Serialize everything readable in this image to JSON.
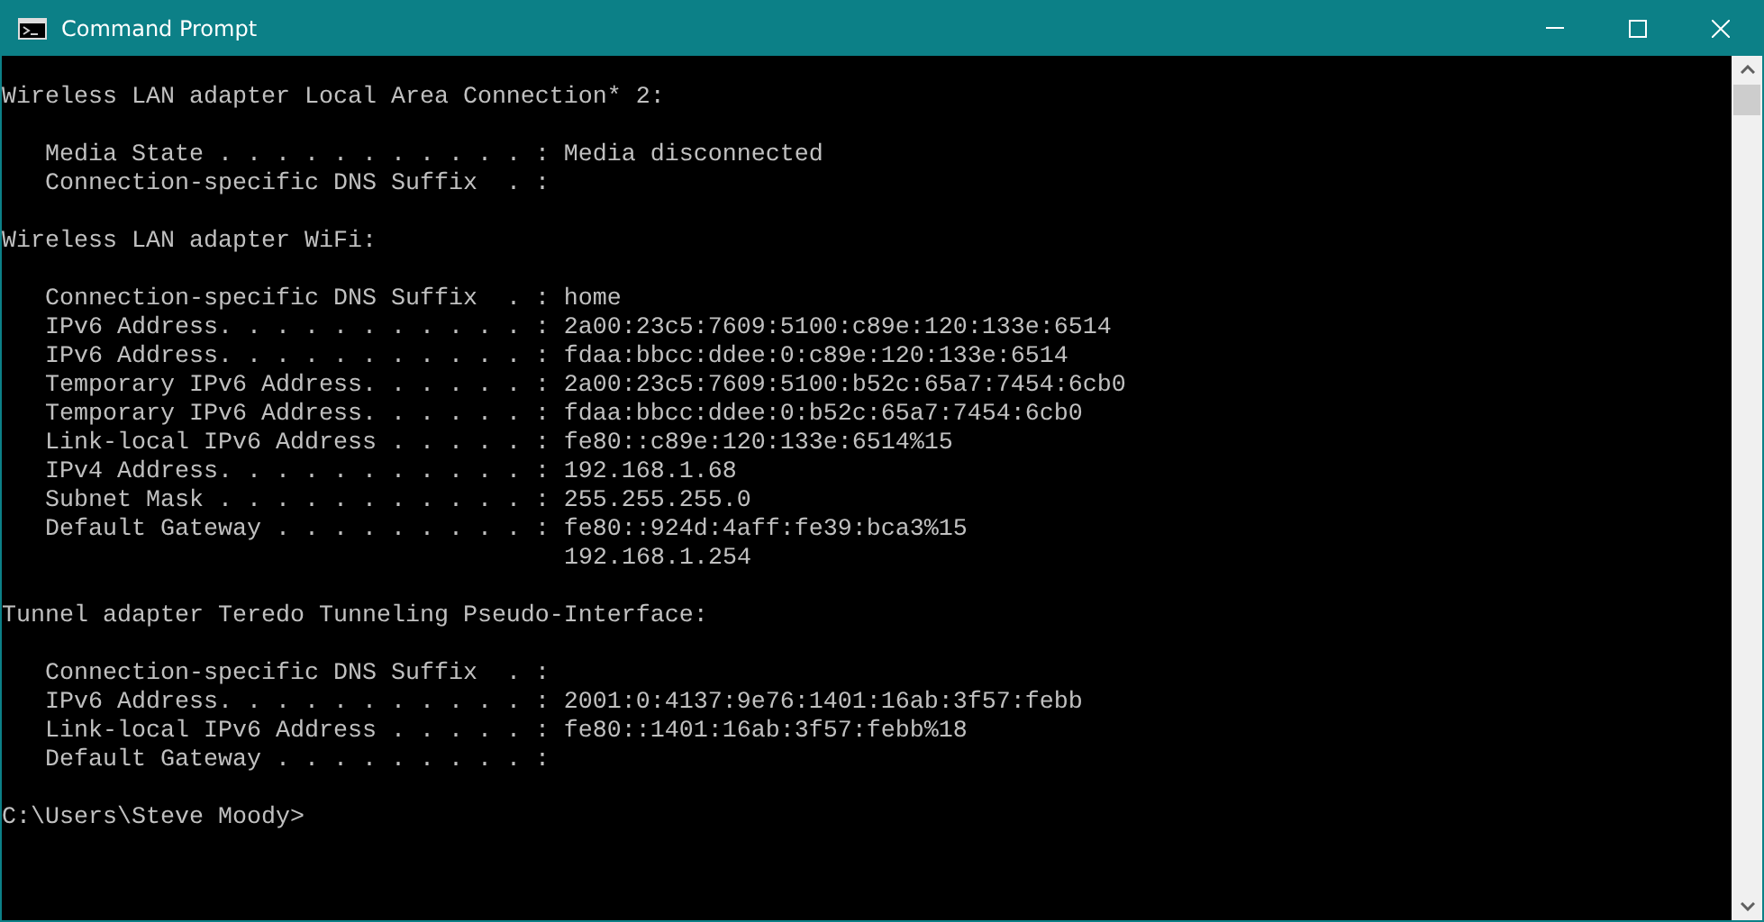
{
  "window": {
    "title": "Command Prompt"
  },
  "sections": [
    {
      "heading": "Wireless LAN adapter Local Area Connection* 2:",
      "entries": [
        {
          "kind": "field",
          "text": "Media State . . . . . . . . . . . : Media disconnected"
        },
        {
          "kind": "field",
          "text": "Connection-specific DNS Suffix  . :"
        }
      ]
    },
    {
      "heading": "Wireless LAN adapter WiFi:",
      "entries": [
        {
          "kind": "field",
          "text": "Connection-specific DNS Suffix  . : home"
        },
        {
          "kind": "field",
          "text": "IPv6 Address. . . . . . . . . . . : 2a00:23c5:7609:5100:c89e:120:133e:6514"
        },
        {
          "kind": "field",
          "text": "IPv6 Address. . . . . . . . . . . : fdaa:bbcc:ddee:0:c89e:120:133e:6514"
        },
        {
          "kind": "field",
          "text": "Temporary IPv6 Address. . . . . . : 2a00:23c5:7609:5100:b52c:65a7:7454:6cb0"
        },
        {
          "kind": "field",
          "text": "Temporary IPv6 Address. . . . . . : fdaa:bbcc:ddee:0:b52c:65a7:7454:6cb0"
        },
        {
          "kind": "field",
          "text": "Link-local IPv6 Address . . . . . : fe80::c89e:120:133e:6514%15"
        },
        {
          "kind": "field",
          "text": "IPv4 Address. . . . . . . . . . . : 192.168.1.68"
        },
        {
          "kind": "field",
          "text": "Subnet Mask . . . . . . . . . . . : 255.255.255.0"
        },
        {
          "kind": "field",
          "text": "Default Gateway . . . . . . . . . : fe80::924d:4aff:fe39:bca3%15"
        },
        {
          "kind": "continuation",
          "text": "192.168.1.254"
        }
      ]
    },
    {
      "heading": "Tunnel adapter Teredo Tunneling Pseudo-Interface:",
      "entries": [
        {
          "kind": "field",
          "text": "Connection-specific DNS Suffix  . :"
        },
        {
          "kind": "field",
          "text": "IPv6 Address. . . . . . . . . . . : 2001:0:4137:9e76:1401:16ab:3f57:febb"
        },
        {
          "kind": "field",
          "text": "Link-local IPv6 Address . . . . . : fe80::1401:16ab:3f57:febb%18"
        },
        {
          "kind": "field",
          "text": "Default Gateway . . . . . . . . . :"
        }
      ]
    }
  ],
  "prompt": "C:\\Users\\Steve Moody>"
}
